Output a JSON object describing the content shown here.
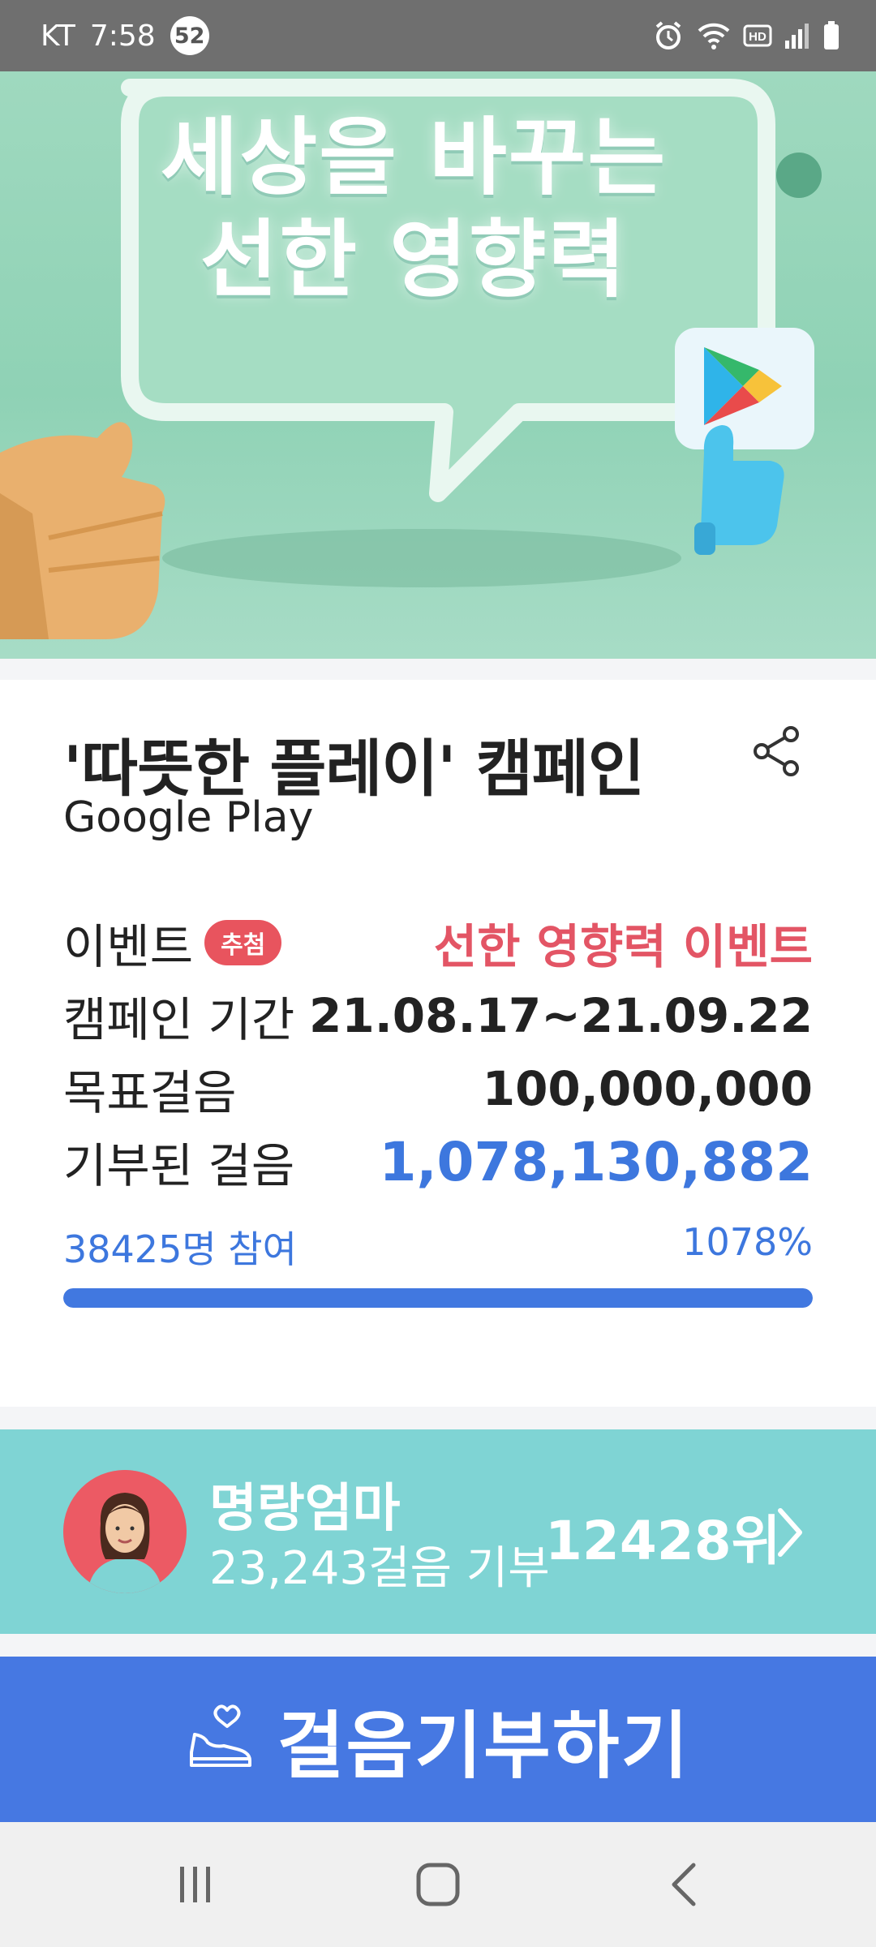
{
  "status_bar": {
    "carrier": "KT",
    "time": "7:58",
    "notification_count": "52",
    "icons": [
      "alarm-icon",
      "wifi-icon",
      "hd-voice-icon",
      "signal-icon",
      "battery-icon"
    ]
  },
  "hero": {
    "line1": "세상을 바꾸는",
    "line2": "선한 영향력"
  },
  "campaign": {
    "title": "'따뜻한 플레이' 캠페인",
    "sponsor": "Google Play",
    "share_icon": "share-icon"
  },
  "details": {
    "event_label": "이벤트",
    "event_tag": "추첨",
    "event_value": "선한 영향력 이벤트",
    "period_label": "캠페인 기간",
    "period_value": "21.08.17~21.09.22",
    "goal_label": "목표걸음",
    "goal_value": "100,000,000",
    "donated_label": "기부된 걸음",
    "donated_value": "1,078,130,882"
  },
  "progress": {
    "participants": "38425명 참여",
    "percent_text": "1078%",
    "fill_fraction": 1.0
  },
  "ranking": {
    "name": "명랑엄마",
    "steps": "23,243걸음 기부",
    "rank": "12428위"
  },
  "donate_button": {
    "label": "걸음기부하기",
    "icon": "sneaker-heart-icon"
  },
  "nav": {
    "icons": [
      "recent-apps-icon",
      "home-icon",
      "back-icon"
    ]
  },
  "colors": {
    "accent_blue": "#4678e2",
    "event_red": "#e35565",
    "teal": "#7fd4d4",
    "hero_green": "#9fd9bf"
  }
}
